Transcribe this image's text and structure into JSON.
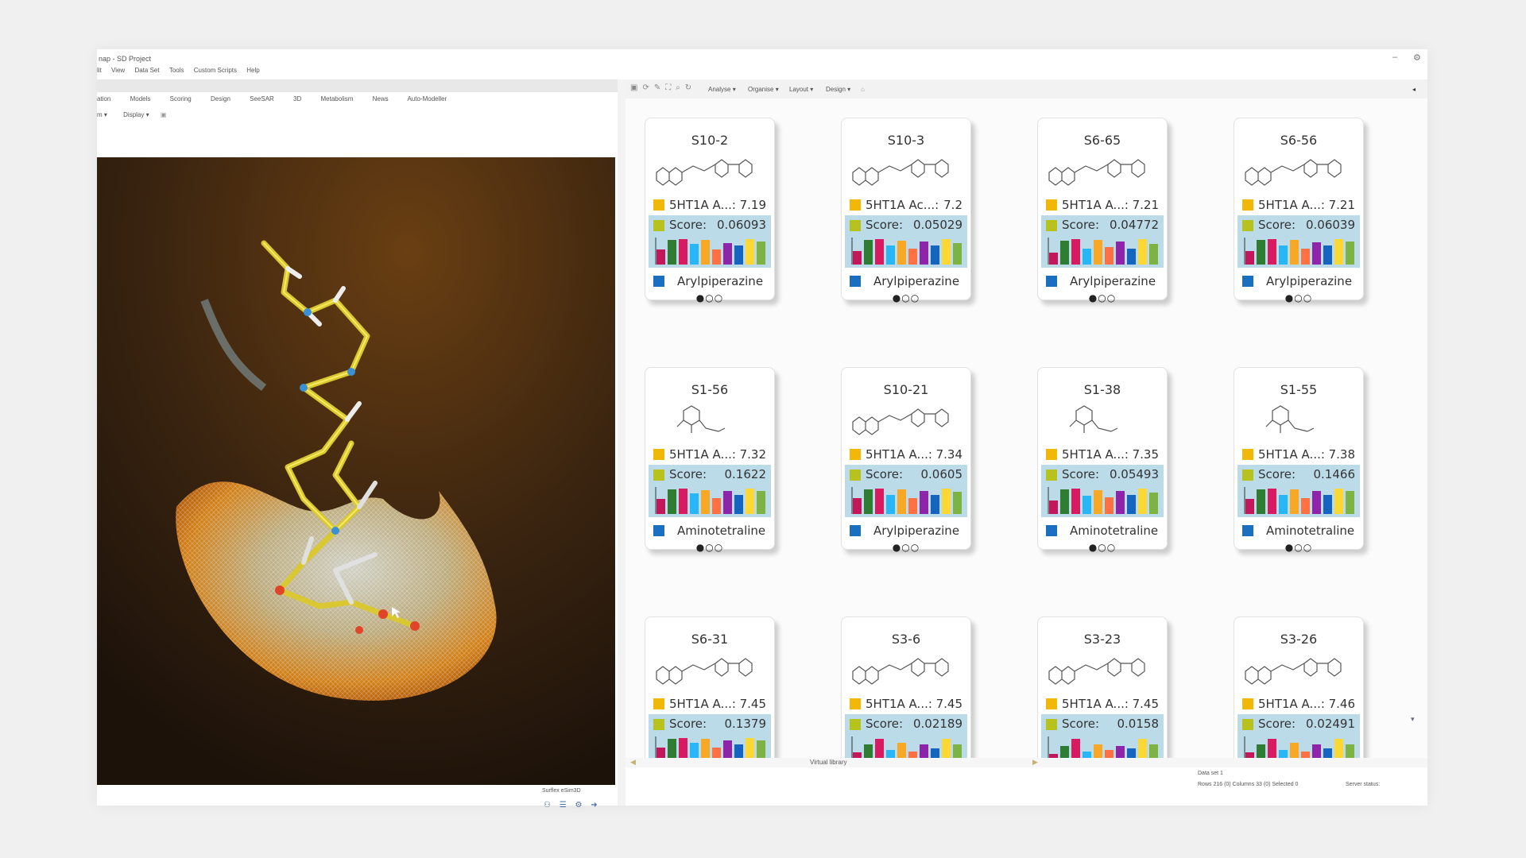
{
  "window": {
    "title": "nap - SD Project",
    "controls": [
      "–",
      "⚙"
    ]
  },
  "menu": [
    "lit",
    "View",
    "Data Set",
    "Tools",
    "Custom Scripts",
    "Help"
  ],
  "left_tabs": [
    "ation",
    "Models",
    "Scoring",
    "Design",
    "SeeSAR",
    "3D",
    "Metabolism",
    "News",
    "Auto-Modeller"
  ],
  "left_toolbar": {
    "view_label": "m",
    "display_label": "Display"
  },
  "viewport_footer": "Surflex eSim3D",
  "right_toolbar": {
    "menus": [
      "Analyse",
      "Organise",
      "Layout",
      "Design"
    ]
  },
  "cards": [
    {
      "id": "S10-2",
      "act_label": "5HT1A A...:",
      "act_value": "7.19",
      "score_label": "Score:",
      "score_value": "0.06093",
      "class": "Arylpiperazine",
      "dots": "●○○",
      "bars": [
        0.55,
        0.9,
        0.95,
        0.75,
        0.9,
        0.55,
        0.8,
        0.7,
        0.95,
        0.85
      ]
    },
    {
      "id": "S10-3",
      "act_label": "5HT1A Ac...:",
      "act_value": "7.2",
      "score_label": "Score:",
      "score_value": "0.05029",
      "class": "Arylpiperazine",
      "dots": "●○○",
      "bars": [
        0.5,
        0.92,
        0.95,
        0.7,
        0.88,
        0.6,
        0.85,
        0.7,
        0.95,
        0.8
      ]
    },
    {
      "id": "S6-65",
      "act_label": "5HT1A A...:",
      "act_value": "7.21",
      "score_label": "Score:",
      "score_value": "0.04772",
      "class": "Arylpiperazine",
      "dots": "●○○",
      "bars": [
        0.45,
        0.88,
        0.95,
        0.6,
        0.9,
        0.65,
        0.85,
        0.6,
        0.95,
        0.75
      ]
    },
    {
      "id": "S6-56",
      "act_label": "5HT1A A...:",
      "act_value": "7.21",
      "score_label": "Score:",
      "score_value": "0.06039",
      "class": "Arylpiperazine",
      "dots": "●○○",
      "bars": [
        0.5,
        0.9,
        0.95,
        0.7,
        0.92,
        0.6,
        0.82,
        0.7,
        0.95,
        0.85
      ]
    },
    {
      "id": "S1-56",
      "act_label": "5HT1A A...:",
      "act_value": "7.32",
      "score_label": "Score:",
      "score_value": "0.1622",
      "class": "Aminotetraline",
      "dots": "●○○",
      "bars": [
        0.55,
        0.9,
        0.95,
        0.75,
        0.88,
        0.6,
        0.85,
        0.7,
        0.95,
        0.85
      ]
    },
    {
      "id": "S10-21",
      "act_label": "5HT1A A...:",
      "act_value": "7.34",
      "score_label": "Score:",
      "score_value": "0.0605",
      "class": "Arylpiperazine",
      "dots": "●○○",
      "bars": [
        0.6,
        0.92,
        0.95,
        0.7,
        0.9,
        0.6,
        0.85,
        0.72,
        0.95,
        0.82
      ]
    },
    {
      "id": "S1-38",
      "act_label": "5HT1A A...:",
      "act_value": "7.35",
      "score_label": "Score:",
      "score_value": "0.05493",
      "class": "Aminotetraline",
      "dots": "●○○",
      "bars": [
        0.5,
        0.9,
        0.95,
        0.68,
        0.88,
        0.62,
        0.85,
        0.7,
        0.95,
        0.8
      ]
    },
    {
      "id": "S1-55",
      "act_label": "5HT1A A...:",
      "act_value": "7.38",
      "score_label": "Score:",
      "score_value": "0.1466",
      "class": "Aminotetraline",
      "dots": "●○○",
      "bars": [
        0.55,
        0.92,
        0.95,
        0.72,
        0.9,
        0.6,
        0.86,
        0.72,
        0.95,
        0.84
      ]
    },
    {
      "id": "S6-31",
      "act_label": "5HT1A A...:",
      "act_value": "7.45",
      "score_label": "Score:",
      "score_value": "0.1379",
      "class": "",
      "dots": "",
      "bars": [
        0.6,
        0.9,
        0.95,
        0.75,
        0.9,
        0.6,
        0.85,
        0.7,
        0.95,
        0.85
      ]
    },
    {
      "id": "S3-6",
      "act_label": "5HT1A A...:",
      "act_value": "7.45",
      "score_label": "Score:",
      "score_value": "0.02189",
      "class": "",
      "dots": "",
      "bars": [
        0.4,
        0.7,
        0.9,
        0.5,
        0.75,
        0.45,
        0.7,
        0.55,
        0.9,
        0.7
      ]
    },
    {
      "id": "S3-23",
      "act_label": "5HT1A A...:",
      "act_value": "7.45",
      "score_label": "Score:",
      "score_value": "0.0158",
      "class": "",
      "dots": "",
      "bars": [
        0.35,
        0.65,
        0.9,
        0.45,
        0.7,
        0.5,
        0.65,
        0.55,
        0.9,
        0.7
      ]
    },
    {
      "id": "S3-26",
      "act_label": "5HT1A A...:",
      "act_value": "7.46",
      "score_label": "Score:",
      "score_value": "0.02491",
      "class": "",
      "dots": "",
      "bars": [
        0.4,
        0.7,
        0.9,
        0.5,
        0.75,
        0.45,
        0.7,
        0.55,
        0.9,
        0.72
      ]
    }
  ],
  "bar_colors": [
    "#c2185b",
    "#2e7d32",
    "#d81b60",
    "#29b6f6",
    "#f9a825",
    "#ff7043",
    "#8e24aa",
    "#1565c0",
    "#fdd835",
    "#7cb342"
  ],
  "bottom": {
    "tab_label": "Virtual library"
  },
  "status": {
    "data_set": "Data set 1",
    "rows": "Rows 216 (0) Columns 33 (0) Selected 0",
    "server": "Server status:"
  }
}
